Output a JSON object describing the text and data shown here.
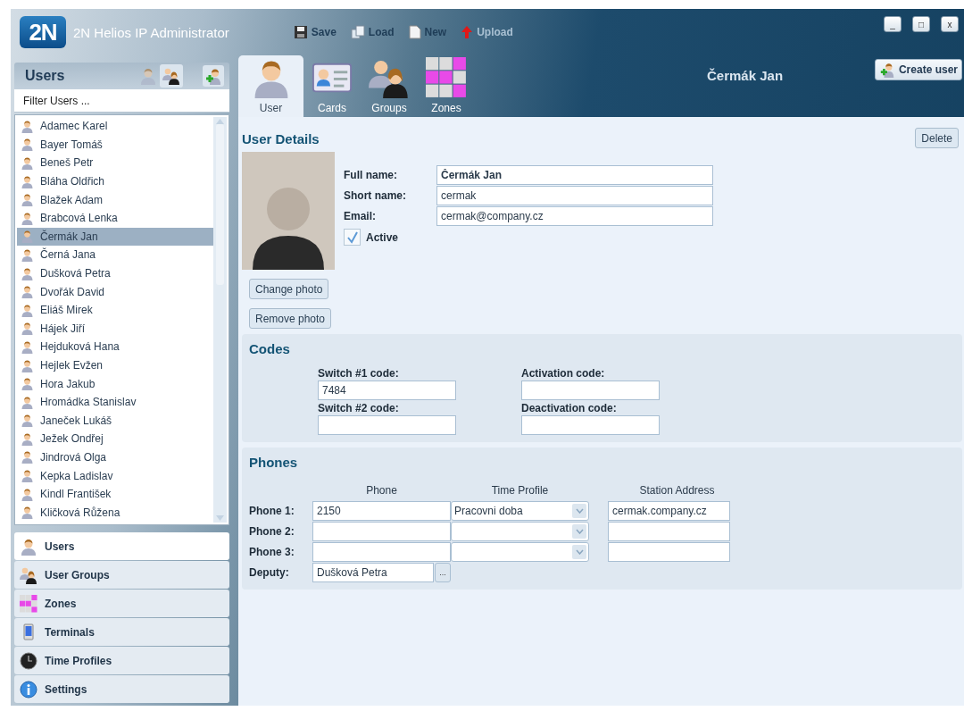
{
  "window": {
    "title": "2N Helios IP Administrator",
    "logo": "2N",
    "controls": [
      "_",
      "□",
      "x"
    ]
  },
  "toolbar": [
    {
      "kind": "save",
      "label": "Save",
      "disabled": false
    },
    {
      "kind": "load",
      "label": "Load",
      "disabled": false
    },
    {
      "kind": "new",
      "label": "New",
      "disabled": false
    },
    {
      "kind": "upload",
      "label": "Upload",
      "disabled": true
    }
  ],
  "users_panel": {
    "title": "Users",
    "view_toggles": [
      {
        "kind": "user",
        "selected": false
      },
      {
        "kind": "group",
        "selected": true
      }
    ],
    "filter": {
      "placeholder": "Filter Users ..."
    },
    "users": [
      {
        "name": "Adamec Karel",
        "selected": false
      },
      {
        "name": "Bayer Tomáš",
        "selected": false
      },
      {
        "name": "Beneš Petr",
        "selected": false
      },
      {
        "name": "Bláha Oldřich",
        "selected": false
      },
      {
        "name": "Blažek Adam",
        "selected": false
      },
      {
        "name": "Brabcová Lenka",
        "selected": false
      },
      {
        "name": "Čermák Jan",
        "selected": true
      },
      {
        "name": "Černá Jana",
        "selected": false
      },
      {
        "name": "Dušková Petra",
        "selected": false
      },
      {
        "name": "Dvořák David",
        "selected": false
      },
      {
        "name": "Eliáš Mirek",
        "selected": false
      },
      {
        "name": "Hájek Jiří",
        "selected": false
      },
      {
        "name": "Hejduková Hana",
        "selected": false
      },
      {
        "name": "Hejlek Evžen",
        "selected": false
      },
      {
        "name": "Hora Jakub",
        "selected": false
      },
      {
        "name": "Hromádka Stanislav",
        "selected": false
      },
      {
        "name": "Janeček Lukáš",
        "selected": false
      },
      {
        "name": "Ježek Ondřej",
        "selected": false
      },
      {
        "name": "Jindrová Olga",
        "selected": false
      },
      {
        "name": "Kepka Ladislav",
        "selected": false
      },
      {
        "name": "Kindl František",
        "selected": false
      },
      {
        "name": "Kličková Růžena",
        "selected": false
      }
    ]
  },
  "nav": [
    {
      "kind": "user",
      "label": "Users",
      "selected": true
    },
    {
      "kind": "group",
      "label": "User Groups",
      "selected": false
    },
    {
      "kind": "zones",
      "label": "Zones",
      "selected": false
    },
    {
      "kind": "terminal",
      "label": "Terminals",
      "selected": false
    },
    {
      "kind": "clock",
      "label": "Time Profiles",
      "selected": false
    },
    {
      "kind": "info",
      "label": "Settings",
      "selected": false
    }
  ],
  "tabs": [
    {
      "kind": "user",
      "label": "User",
      "selected": true
    },
    {
      "kind": "card",
      "label": "Cards",
      "selected": false
    },
    {
      "kind": "group",
      "label": "Groups",
      "selected": false
    },
    {
      "kind": "zones",
      "label": "Zones",
      "selected": false
    }
  ],
  "header_name": "Čermák Jan",
  "create_button": "Create user",
  "details": {
    "title": "User Details",
    "delete": "Delete",
    "fields": [
      {
        "label": "Full name:",
        "value": "Čermák Jan",
        "bold": true
      },
      {
        "label": "Short name:",
        "value": "cermak",
        "bold": false
      },
      {
        "label": "Email:",
        "value": "cermak@company.cz",
        "bold": false
      }
    ],
    "active": {
      "label": "Active",
      "checked": true
    },
    "photo_buttons": [
      "Change photo",
      "Remove photo"
    ]
  },
  "codes": {
    "title": "Codes",
    "fields": [
      {
        "label": "Switch #1 code:",
        "value": "7484"
      },
      {
        "label": "Activation code:"
      },
      {
        "label": "Switch #2 code:"
      },
      {
        "label": "Deactivation code:"
      }
    ]
  },
  "phones": {
    "title": "Phones",
    "columns": [
      "Phone",
      "Time Profile",
      "Station Address"
    ],
    "rows": [
      {
        "label": "Phone 1:",
        "phone": "2150",
        "time_profile": "Pracovni doba",
        "station": "cermak.company.cz"
      },
      {
        "label": "Phone 2:"
      },
      {
        "label": "Phone 3:"
      }
    ],
    "deputy": {
      "label": "Deputy:",
      "value": "Dušková Petra",
      "browse": "..."
    }
  }
}
